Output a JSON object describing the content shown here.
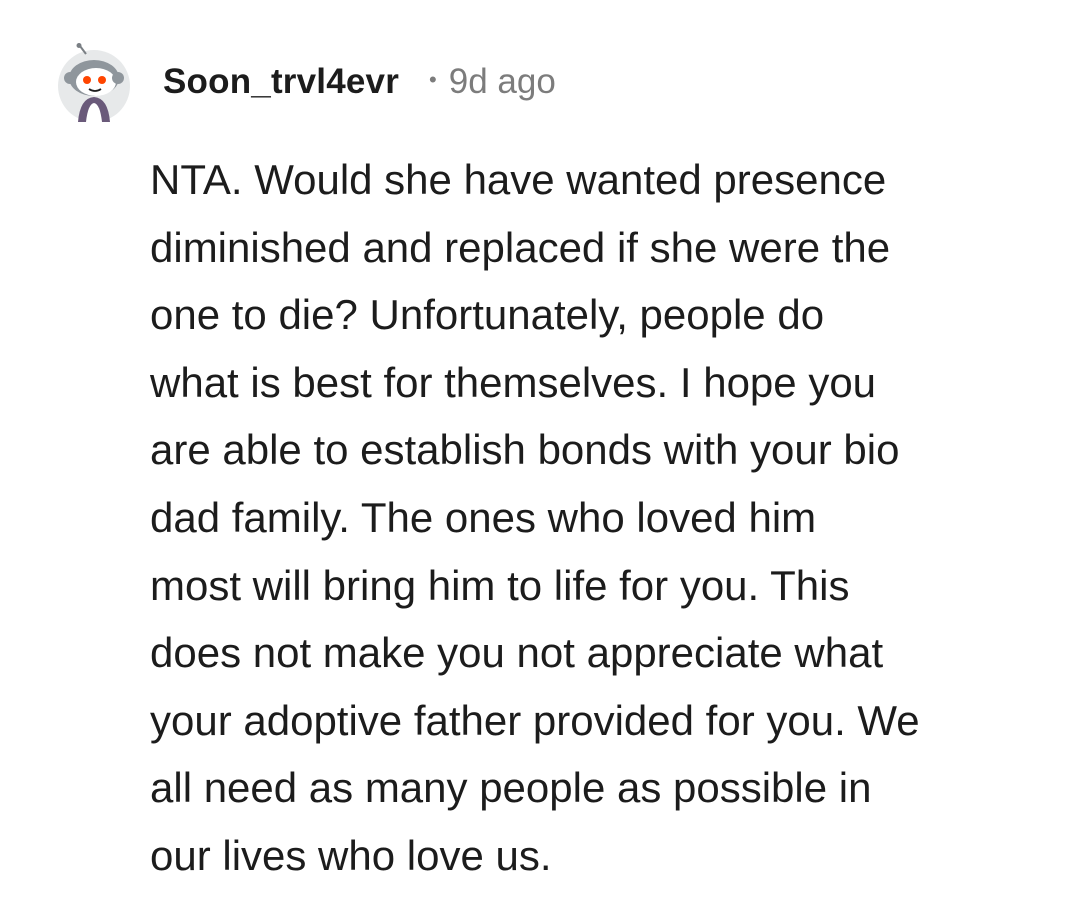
{
  "comment": {
    "author": "Soon_trvl4evr",
    "separator": "•",
    "age": "9d ago",
    "avatar_icon": "snoo-avatar-icon",
    "body_lines": [
      "NTA. Would she have wanted presence",
      "diminished and replaced if she were the",
      "one to die? Unfortunately, people do",
      "what is best for themselves. I hope you",
      "are able to establish bonds with your bio",
      "dad family. The ones who loved him",
      "most will bring him to life for you. This",
      "does not make you not appreciate what",
      "your adoptive father provided for you. We",
      "all need as many people as possible in",
      "our lives who love us."
    ]
  },
  "colors": {
    "text": "#1c1c1c",
    "meta": "#7c7c7c",
    "background": "#ffffff"
  }
}
